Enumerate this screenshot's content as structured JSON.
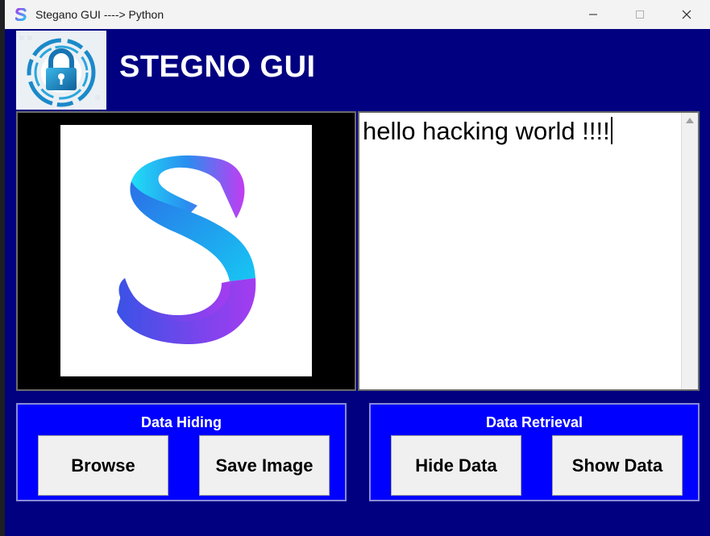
{
  "window": {
    "title": "Stegano GUI ----> Python"
  },
  "header": {
    "heading": "STEGNO GUI"
  },
  "message": {
    "text": "hello hacking world !!!!"
  },
  "data_hiding": {
    "title": "Data Hiding",
    "browse_label": "Browse",
    "save_label": "Save Image"
  },
  "data_retrieval": {
    "title": "Data Retrieval",
    "hide_label": "Hide Data",
    "show_label": "Show Data"
  },
  "colors": {
    "window_bg": "#000080",
    "group_bg": "#0000ff",
    "heading": "#ffffff"
  },
  "icons": {
    "app": "s-logo-icon",
    "header_logo": "padlock-icon",
    "loaded_image": "s-logo-image"
  }
}
